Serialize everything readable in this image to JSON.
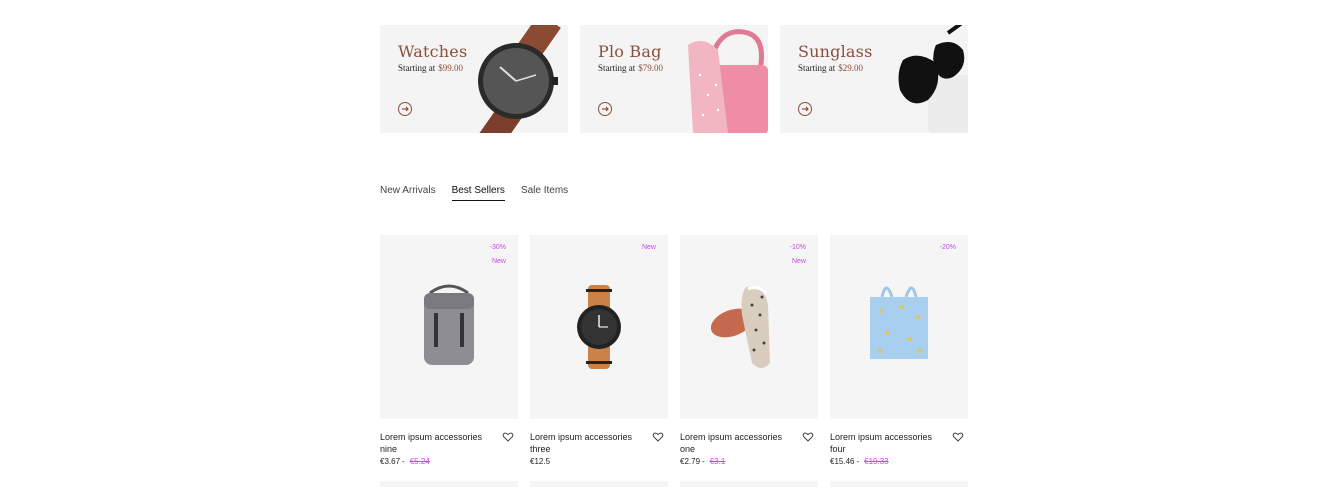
{
  "banners": [
    {
      "title": "Watches",
      "starting_label": "Starting at",
      "price": "$99.00",
      "icon": "watch"
    },
    {
      "title": "Plo Bag",
      "starting_label": "Starting at",
      "price": "$79.00",
      "icon": "bag"
    },
    {
      "title": "Sunglass",
      "starting_label": "Starting at",
      "price": "$29.00",
      "icon": "sunglasses"
    }
  ],
  "tabs": [
    {
      "label": "New Arrivals",
      "active": false
    },
    {
      "label": "Best Sellers",
      "active": true
    },
    {
      "label": "Sale Items",
      "active": false
    }
  ],
  "products": [
    {
      "name": "Lorem ipsum accessories nine",
      "badges": [
        "-30%",
        "New"
      ],
      "price": "€3.67",
      "old_price": "€5.24",
      "image": "backpack"
    },
    {
      "name": "Lorem ipsum accessories three",
      "badges": [
        "New"
      ],
      "price": "€12.5",
      "old_price": "",
      "image": "watch"
    },
    {
      "name": "Lorem ipsum accessories one",
      "badges": [
        "-10%",
        "New"
      ],
      "price": "€2.79",
      "old_price": "€3.1",
      "image": "shoe"
    },
    {
      "name": "Lorem ipsum accessories four",
      "badges": [
        "-20%"
      ],
      "price": "€15.46",
      "old_price": "€19.33",
      "image": "tote-bag"
    }
  ],
  "colors": {
    "brand": "#8a4e3b",
    "badge": "#c44ce6",
    "card_bg": "#f5f5f5"
  }
}
